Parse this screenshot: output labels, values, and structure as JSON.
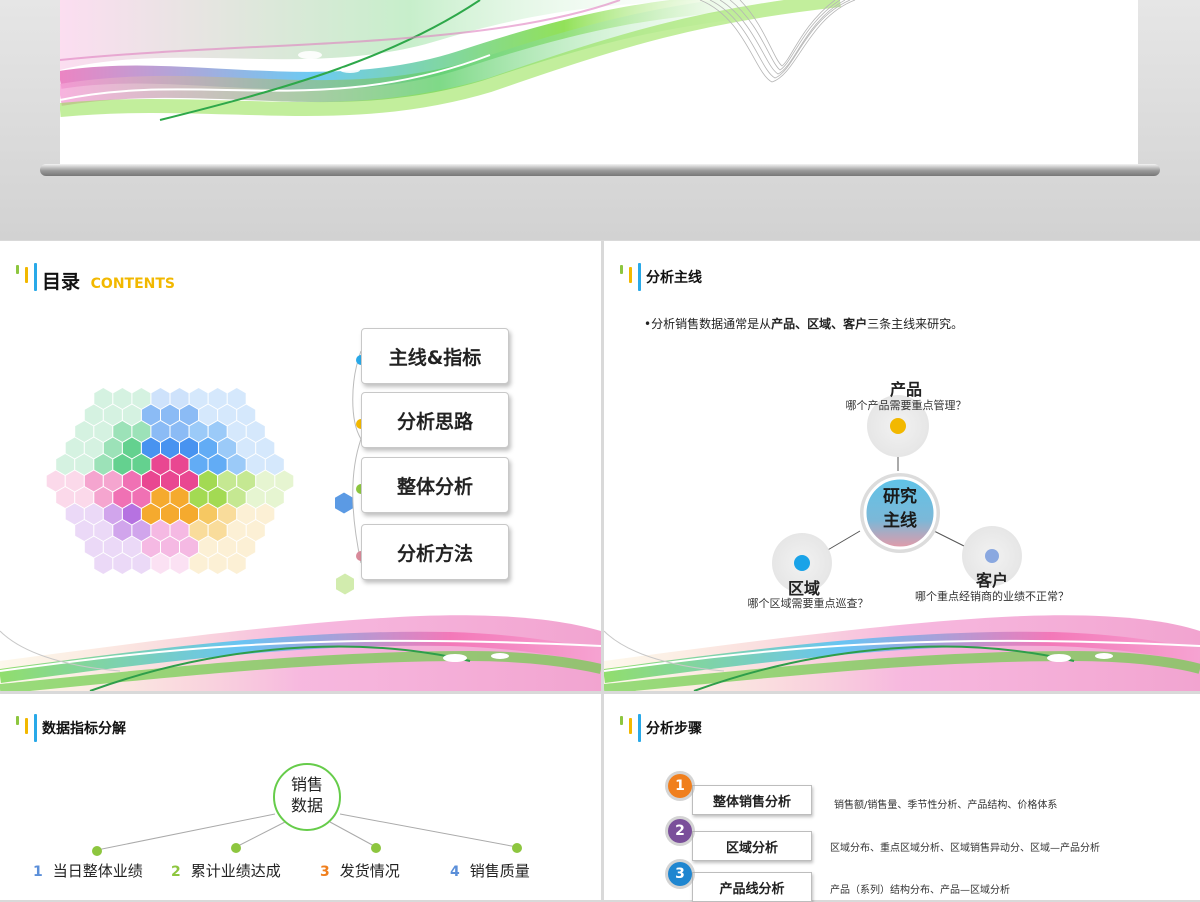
{
  "contents_slide": {
    "title": "目录",
    "title_en": "CONTENTS",
    "items": [
      {
        "label": "主线&指标",
        "dot_color": "#29a9e8"
      },
      {
        "label": "分析思路",
        "dot_color": "#f2b800"
      },
      {
        "label": "整体分析",
        "dot_color": "#8dc63f"
      },
      {
        "label": "分析方法",
        "dot_color": "#d98a9a"
      }
    ]
  },
  "mainline_slide": {
    "title": "分析主线",
    "intro_prefix": "•分析销售数据通常是从",
    "intro_bold": "产品、区域、客户",
    "intro_suffix": "三条主线来研究。",
    "center": {
      "line1": "研究",
      "line2": "主线"
    },
    "nodes": {
      "product": {
        "label": "产品",
        "desc": "哪个产品需要重点管理？",
        "color": "#f2b800"
      },
      "region": {
        "label": "区域",
        "desc": "哪个区域需要重点巡查？",
        "color": "#1aa3e8"
      },
      "customer": {
        "label": "客户",
        "desc": "哪个重点经销商的业绩不正常？",
        "color": "#8aa8e0"
      }
    }
  },
  "indicators_slide": {
    "title": "数据指标分解",
    "center": {
      "line1": "销售",
      "line2": "数据"
    },
    "items": [
      {
        "num": "1",
        "label": "当日整体业绩",
        "color": "#5b8fd9"
      },
      {
        "num": "2",
        "label": "累计业绩达成",
        "color": "#8dc63f"
      },
      {
        "num": "3",
        "label": "发货情况",
        "color": "#f07f1d"
      },
      {
        "num": "4",
        "label": "销售质量",
        "color": "#5b8fd9"
      }
    ]
  },
  "steps_slide": {
    "title": "分析步骤",
    "steps": [
      {
        "num": "1",
        "label": "整体销售分析",
        "desc": "销售额/销售量、季节性分析、产品结构、价格体系",
        "color": "#f07f1d"
      },
      {
        "num": "2",
        "label": "区域分析",
        "desc": "区域分布、重点区域分析、区域销售异动分、区域—产品分析",
        "color": "#7a4f9a"
      },
      {
        "num": "3",
        "label": "产品线分析",
        "desc": "产品（系列）结构分布、产品—区域分析",
        "color": "#1f86d0"
      }
    ]
  }
}
